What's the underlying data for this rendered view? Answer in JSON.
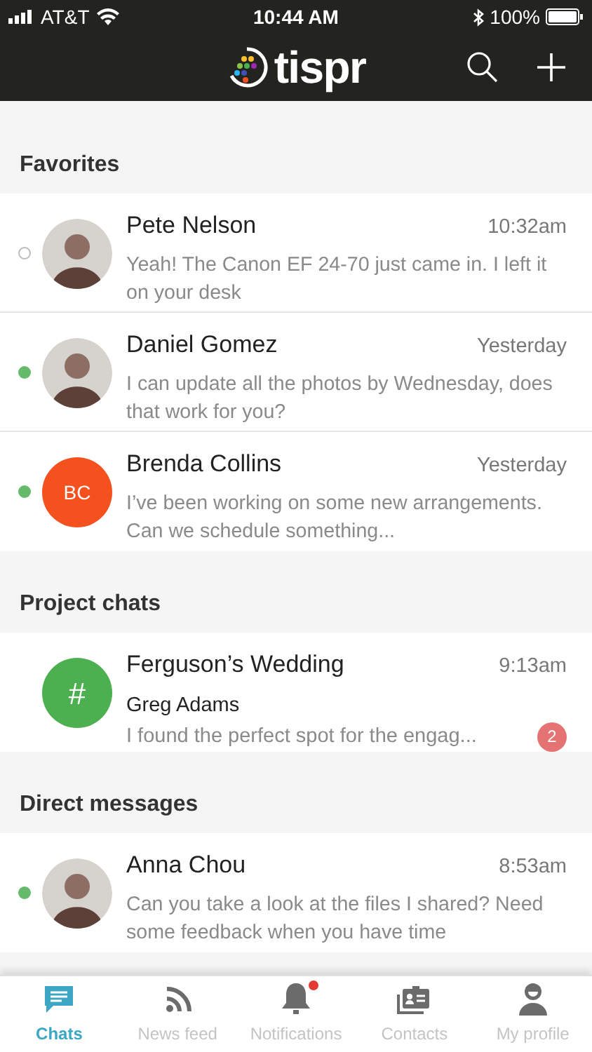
{
  "status_bar": {
    "carrier": "AT&T",
    "time": "10:44 AM",
    "battery": "100%"
  },
  "header": {
    "logo_text": "tispr"
  },
  "sections": [
    {
      "title": "Favorites",
      "chats": [
        {
          "name": "Pete Nelson",
          "time": "10:32am",
          "preview": "Yeah! The Canon EF 24-70 just came in. I left it on your desk",
          "online": false
        },
        {
          "name": "Daniel Gomez",
          "time": "Yesterday",
          "preview": "I can update all the photos by Wednesday, does that work for you?",
          "online": true
        },
        {
          "kind": "initials",
          "initials": "BC",
          "color": "#f4511e",
          "name": "Brenda Collins",
          "time": "Yesterday",
          "preview": "I’ve been working on some new arrangements. Can we schedule something...",
          "online": true
        }
      ]
    },
    {
      "title": "Project chats",
      "chats": [
        {
          "kind": "channel",
          "symbol": "#",
          "color": "#4caf50",
          "name": "Ferguson’s Wedding",
          "time": "9:13am",
          "sender": "Greg Adams",
          "preview": "I found the perfect spot for the engag...",
          "unread": "2"
        }
      ]
    },
    {
      "title": "Direct messages",
      "chats": [
        {
          "name": "Anna Chou",
          "time": "8:53am",
          "preview": "Can you take a look at the files I shared? Need some feedback when you have time",
          "online": true
        }
      ]
    }
  ],
  "tabs": [
    {
      "kind": "chat",
      "label": "Chats",
      "selected": true,
      "alert": false
    },
    {
      "kind": "feed",
      "label": "News feed",
      "selected": false,
      "alert": false
    },
    {
      "kind": "bell",
      "label": "Notifications",
      "selected": false,
      "alert": true
    },
    {
      "kind": "contacts",
      "label": "Contacts",
      "selected": false,
      "alert": false
    },
    {
      "kind": "profile",
      "label": "My profile",
      "selected": false,
      "alert": false
    }
  ]
}
